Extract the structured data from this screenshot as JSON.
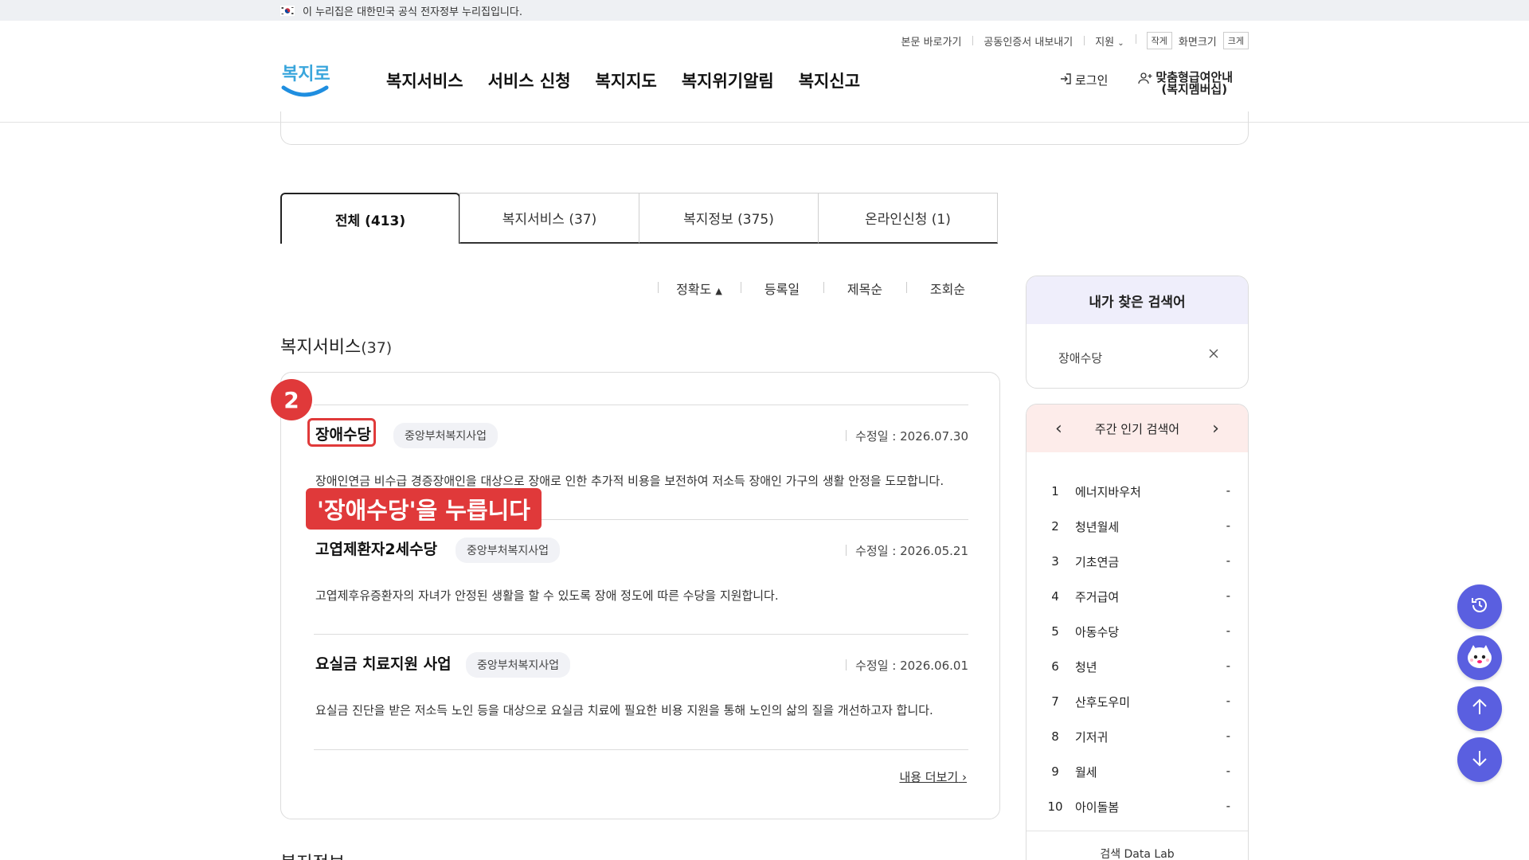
{
  "gov_banner": {
    "text": "이 누리집은 대한민국 공식 전자정부 누리집입니다."
  },
  "header": {
    "utils": [
      "본문 바로가기",
      "공동인증서 내보내기",
      "지원"
    ],
    "font_size": {
      "small": "작게",
      "label": "화면크기",
      "large": "크게"
    },
    "logo_text": "복지로",
    "nav": [
      "복지서비스",
      "서비스 신청",
      "복지지도",
      "복지위기알림",
      "복지신고"
    ],
    "login": "로그인",
    "member_line1": "맞춤형급여안내",
    "member_line2": "(복지멤버십)"
  },
  "tabs": [
    {
      "label": "전체  (413)",
      "active": true
    },
    {
      "label": "복지서비스 (37)",
      "active": false
    },
    {
      "label": "복지정보 (375)",
      "active": false
    },
    {
      "label": "온라인신청 (1)",
      "active": false
    }
  ],
  "sort": {
    "accuracy": "정확도",
    "registered": "등록일",
    "title": "제목순",
    "views": "조회순"
  },
  "section": {
    "title": "복지서비스",
    "count": "(37)"
  },
  "results": [
    {
      "title": "장애수당",
      "tag": "중앙부처복지사업",
      "date": "수정일 : 2026.07.30",
      "desc": "장애인연금 비수급 경증장애인을 대상으로 장애로 인한 추가적 비용을 보전하여 저소득 장애인 가구의 생활 안정을 도모합니다."
    },
    {
      "title": "고엽제환자2세수당",
      "tag": "중앙부처복지사업",
      "date": "수정일 : 2026.05.21",
      "desc": "고엽제후유증환자의 자녀가 안정된 생활을 할 수 있도록 장애 정도에 따른 수당을 지원합니다."
    },
    {
      "title": "요실금 치료지원 사업",
      "tag": "중앙부처복지사업",
      "date": "수정일 : 2026.06.01",
      "desc": "요실금 진단을 받은 저소득 노인 등을 대상으로 요실금 치료에 필요한 비용 지원을 통해 노인의 삶의 질을 개선하고자 합니다."
    }
  ],
  "more": "내용 더보기",
  "annotation": {
    "step": "2",
    "callout": "'장애수당'을 누릅니다"
  },
  "next_section": "복지정보",
  "my_search": {
    "title": "내가 찾은 검색어",
    "keyword": "장애수당"
  },
  "popular": {
    "title": "주간 인기 검색어",
    "items": [
      {
        "rank": "1",
        "keyword": "에너지바우처",
        "change": "-"
      },
      {
        "rank": "2",
        "keyword": "청년월세",
        "change": "-"
      },
      {
        "rank": "3",
        "keyword": "기초연금",
        "change": "-"
      },
      {
        "rank": "4",
        "keyword": "주거급여",
        "change": "-"
      },
      {
        "rank": "5",
        "keyword": "아동수당",
        "change": "-"
      },
      {
        "rank": "6",
        "keyword": "청년",
        "change": "-"
      },
      {
        "rank": "7",
        "keyword": "산후도우미",
        "change": "-"
      },
      {
        "rank": "8",
        "keyword": "기저귀",
        "change": "-"
      },
      {
        "rank": "9",
        "keyword": "월세",
        "change": "-"
      },
      {
        "rank": "10",
        "keyword": "아이돌봄",
        "change": "-"
      }
    ],
    "footer": "검색 Data Lab"
  },
  "colors": {
    "accent": "#5a5fe0",
    "highlight": "#e0393a",
    "logo_blue": "#1fa3e0"
  }
}
